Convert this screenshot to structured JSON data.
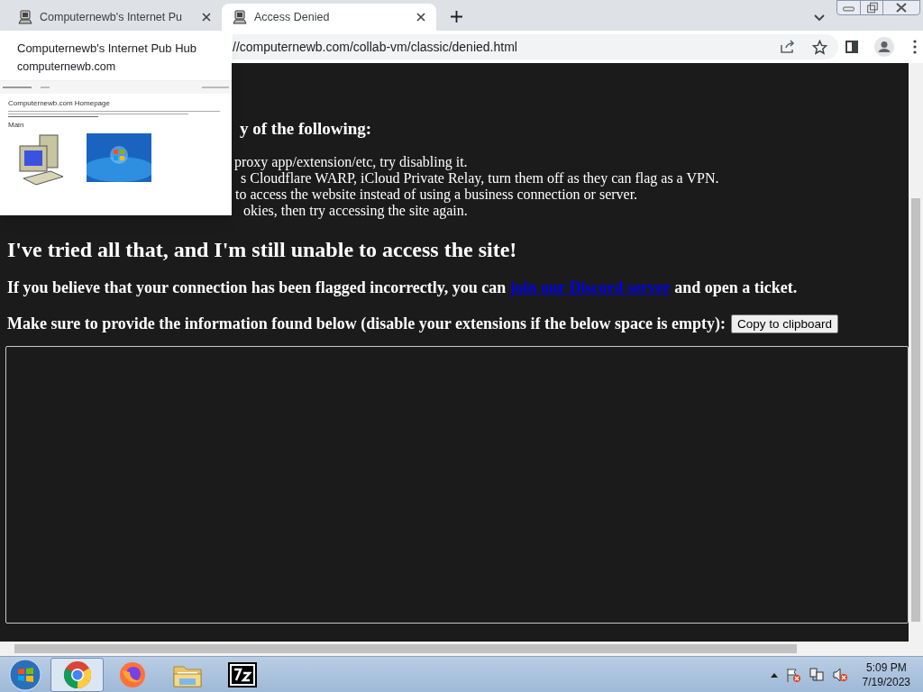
{
  "tabs": [
    {
      "title": "Computernewb's Internet Pu",
      "selected": false
    },
    {
      "title": "Access Denied",
      "selected": true
    }
  ],
  "address": "//computernewb.com/collab-vm/classic/denied.html",
  "hover_card": {
    "title": "Computernewb's Internet Pub Hub",
    "domain": "computernewb.com",
    "preview_heading": "Computernewb.com Homepage",
    "preview_section": "Main"
  },
  "page": {
    "list_heading": "y of the following:",
    "list_items": [
      {
        "text": "proxy app/extension/etc, try disabling it."
      },
      {
        "text": "s Cloudflare WARP, iCloud Private Relay, turn them off as they can flag as a VPN."
      },
      {
        "text": "to access the website instead of using a business connection or server."
      },
      {
        "text": "okies, then try accessing the site again."
      }
    ],
    "heading": "I've tried all that, and I'm still unable to access the site!",
    "ticket_paragraph": {
      "before": "If you believe that your connection has been flagged incorrectly, you can ",
      "link": "join our Discord server",
      "after": " and open a ticket."
    },
    "info_prompt": "Make sure to provide the information found below (disable your extensions if the below space is empty):",
    "copy_button": "Copy to clipboard"
  },
  "taskbar": {
    "apps": [
      {
        "kind": "chrome",
        "selected": true
      },
      {
        "kind": "firefox",
        "selected": false
      },
      {
        "kind": "explorer",
        "selected": false
      },
      {
        "kind": "sevenzip",
        "selected": false
      }
    ],
    "time": "5:09 PM",
    "date": "7/19/2023"
  }
}
